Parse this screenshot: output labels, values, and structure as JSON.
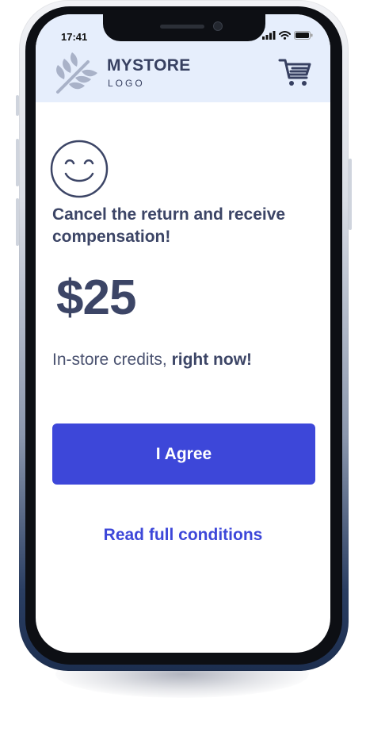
{
  "status_bar": {
    "time": "17:41",
    "icons": [
      "cellular-signal-icon",
      "wifi-icon",
      "battery-icon"
    ]
  },
  "header": {
    "logo_icon": "leaf-icon",
    "brand_name": "MYSTORE",
    "brand_sub": "LOGO",
    "cart_icon": "shopping-cart-icon"
  },
  "offer": {
    "icon": "smiley-face-icon",
    "headline": "Cancel the return and receive compensation!",
    "amount": "$25",
    "credits_text": "In-store credits, ",
    "credits_emphasis": "right now!"
  },
  "actions": {
    "agree_label": "I Agree",
    "conditions_label": "Read full conditions"
  },
  "colors": {
    "header_bg": "#e6eefc",
    "primary": "#3d47d9",
    "text_dark": "#3c4566"
  }
}
